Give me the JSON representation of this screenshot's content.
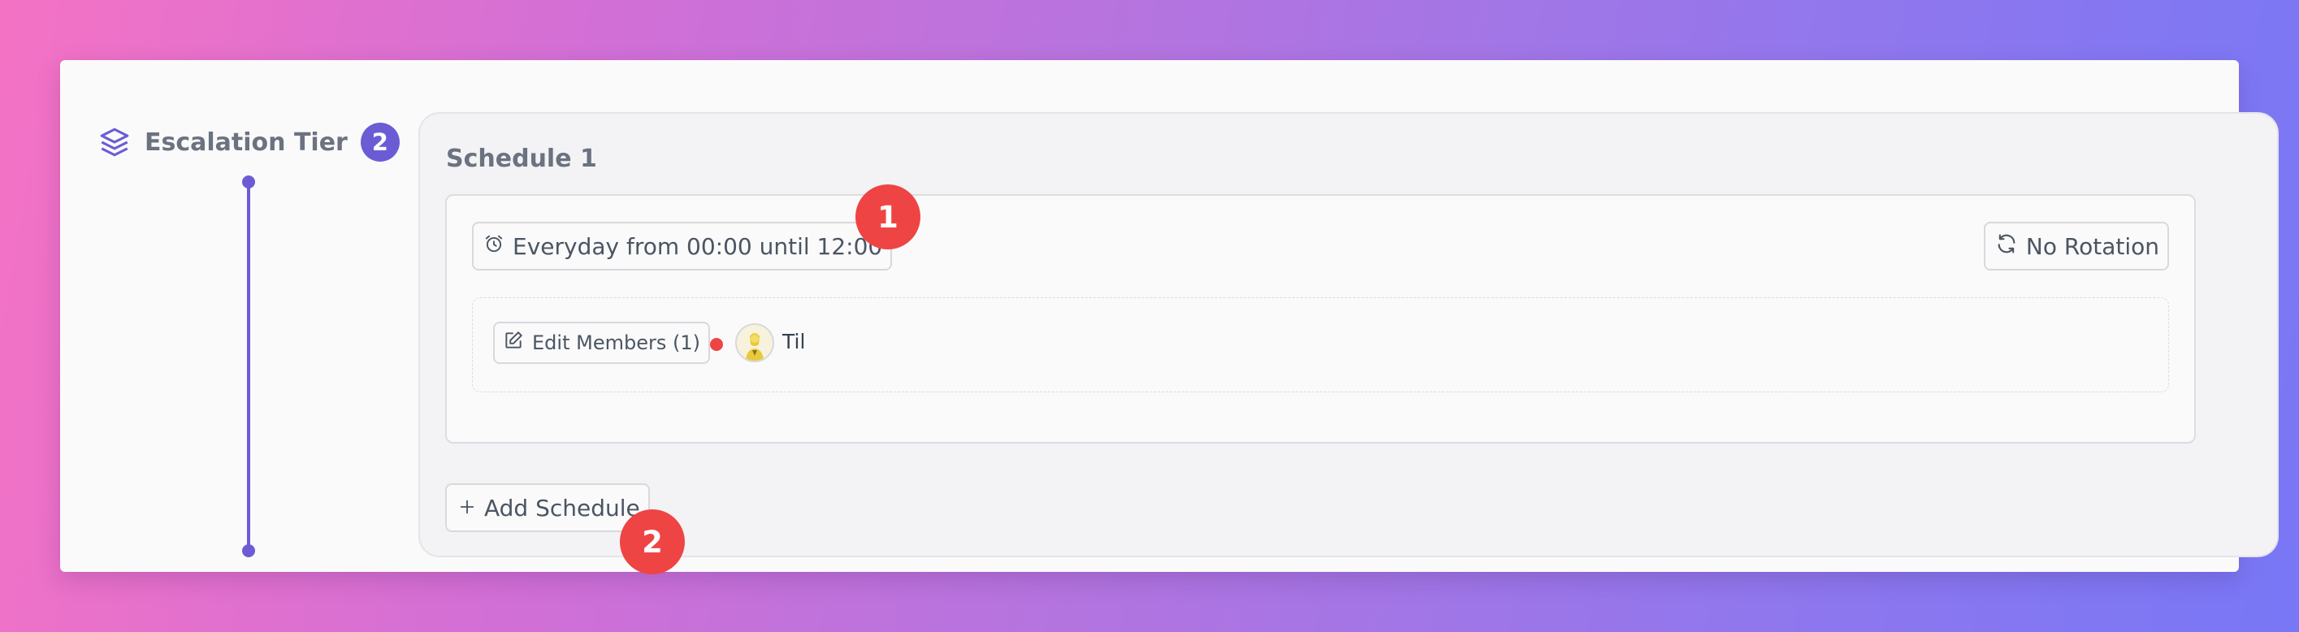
{
  "colors": {
    "accent": "#6b5cd6",
    "callout": "#ef4444",
    "status_dot": "#ef4444"
  },
  "tier": {
    "icon": "layers-icon",
    "title": "Escalation Tier",
    "badge": "2"
  },
  "schedule": {
    "title": "Schedule 1",
    "time_icon": "alarm-clock-icon",
    "time_label": "Everyday from 00:00 until 12:00",
    "rotation_icon": "refresh-icon",
    "rotation_label": "No Rotation",
    "edit_icon": "edit-icon",
    "edit_members_label": "Edit Members (1)",
    "members": [
      {
        "name": "Til",
        "avatar": "avatar-icon",
        "status": "offline"
      }
    ]
  },
  "add_schedule": {
    "icon": "plus-icon",
    "label": "Add Schedule"
  },
  "callouts": [
    "1",
    "2"
  ]
}
